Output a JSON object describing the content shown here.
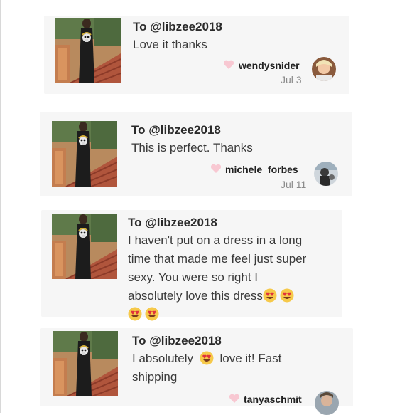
{
  "reviews": [
    {
      "to": "To @libzee2018",
      "message_lines": [
        "Love it thanks"
      ],
      "username": "wendysnider",
      "date": "Jul 3"
    },
    {
      "to": "To @libzee2018",
      "message_lines": [
        "This is perfect. Thanks"
      ],
      "username": "michele_forbes",
      "date": "Jul 11"
    },
    {
      "to": "To @libzee2018",
      "message_lines": [
        "I haven't put on a dress in a long",
        "time that made me feel just super",
        "sexy. You were so right I",
        "absolutely love this dress"
      ],
      "username": "",
      "date": ""
    },
    {
      "to": "To @libzee2018",
      "message_lines": [
        "I absolutely",
        "love it! Fast",
        "shipping"
      ],
      "username": "tanyaschmit",
      "date": ""
    }
  ],
  "icons": {
    "like": "heart-icon",
    "emoji": "heart-eyes-emoji"
  },
  "colors": {
    "card_bg": "#f6f6f6",
    "heart": "#f8c8d2",
    "date": "#8a8a8a"
  }
}
